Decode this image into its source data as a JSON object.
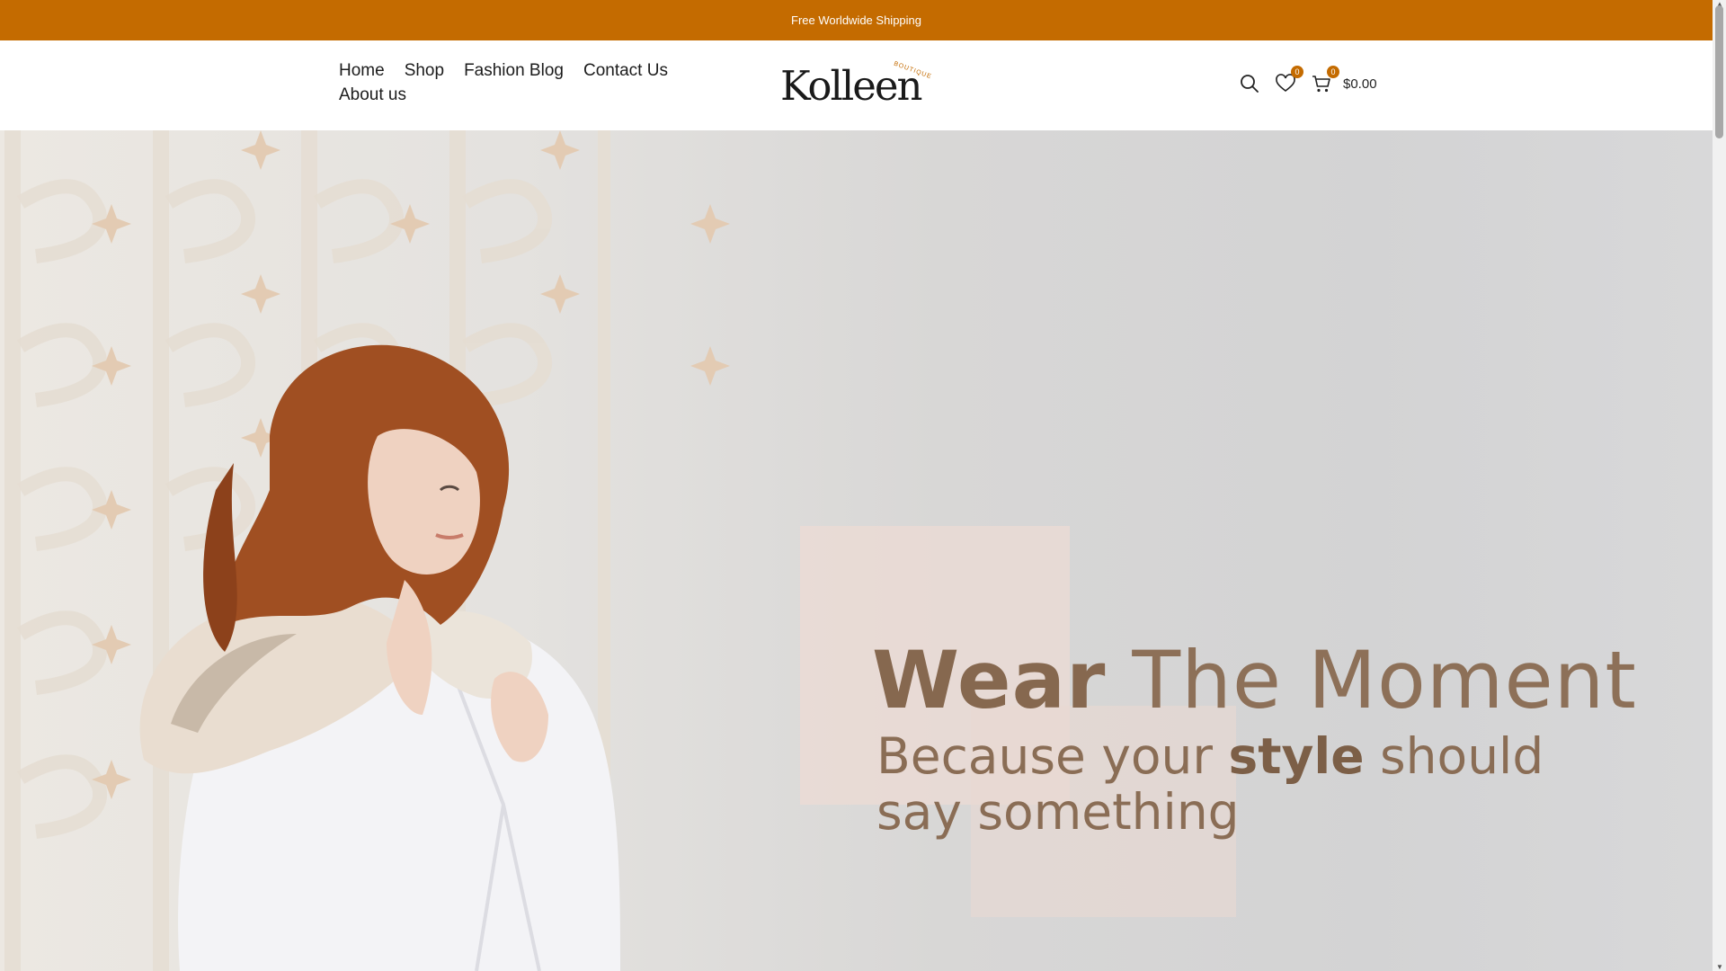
{
  "topbar": {
    "text": "Free Worldwide Shipping"
  },
  "nav": {
    "items": [
      "Home",
      "Shop",
      "Fashion Blog",
      "Contact Us",
      "About us"
    ]
  },
  "logo": {
    "text": "Kolleen",
    "sub": "BOUTIQUE"
  },
  "header": {
    "wishlist_count": "0",
    "cart_count": "0",
    "cart_total": "$0.00"
  },
  "hero": {
    "title_bold": "Wear",
    "title_rest": " The Moment",
    "subtitle_pre": "Because your ",
    "subtitle_bold": "style",
    "subtitle_post": " should say something"
  },
  "colors": {
    "accent": "#c46b00",
    "hero_text": "#86684f"
  },
  "icons": [
    "search-icon",
    "heart-icon",
    "cart-icon",
    "sparkle-icon"
  ]
}
